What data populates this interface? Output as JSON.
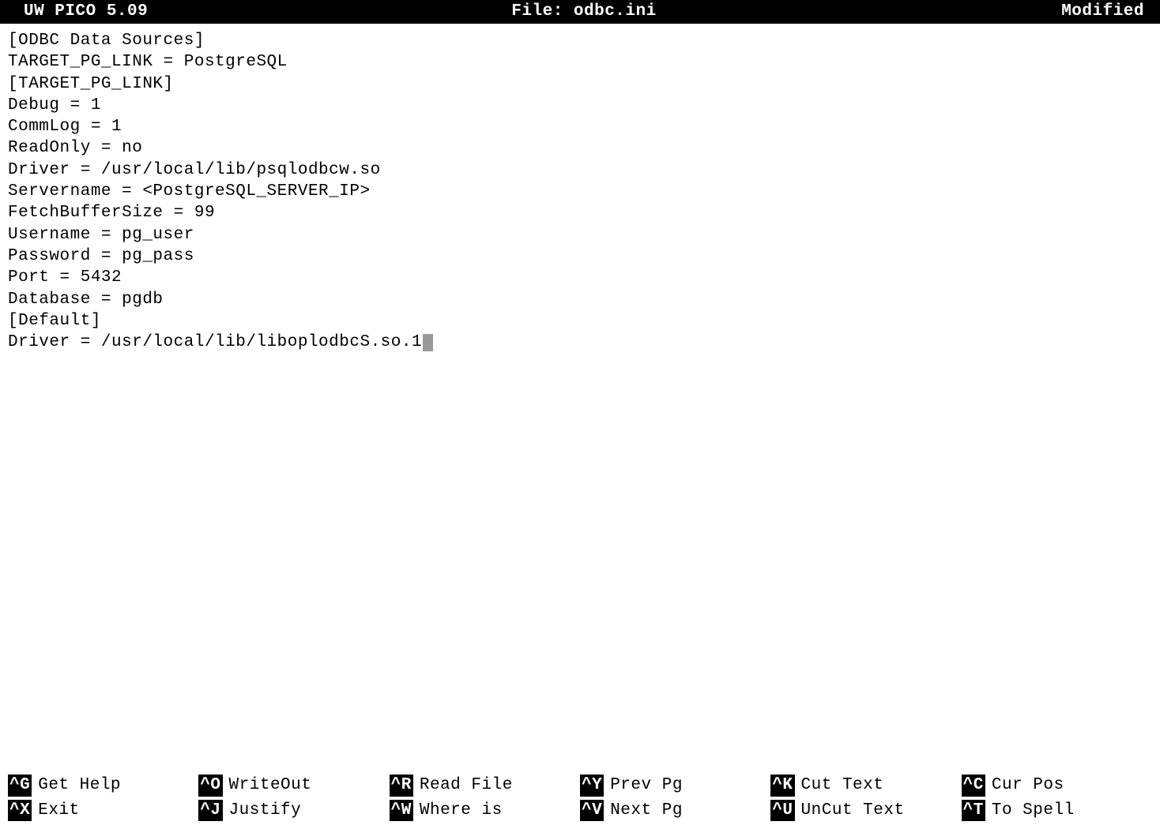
{
  "title_bar": {
    "left": "UW PICO 5.09",
    "center": "File: odbc.ini",
    "right": "Modified"
  },
  "editor": {
    "lines": [
      "[ODBC Data Sources]",
      "TARGET_PG_LINK = PostgreSQL",
      "[TARGET_PG_LINK]",
      "Debug = 1",
      "CommLog = 1",
      "ReadOnly = no",
      "Driver = /usr/local/lib/psqlodbcw.so",
      "Servername = <PostgreSQL_SERVER_IP>",
      "FetchBufferSize = 99",
      "Username = pg_user",
      "Password = pg_pass",
      "Port = 5432",
      "Database = pgdb",
      "[Default]",
      "Driver = /usr/local/lib/liboplodbcS.so.1"
    ],
    "cursor_line": 14
  },
  "shortcuts": [
    {
      "key": "^G",
      "label": "Get Help"
    },
    {
      "key": "^O",
      "label": "WriteOut"
    },
    {
      "key": "^R",
      "label": "Read File"
    },
    {
      "key": "^Y",
      "label": "Prev Pg"
    },
    {
      "key": "^K",
      "label": "Cut Text"
    },
    {
      "key": "^C",
      "label": "Cur Pos"
    },
    {
      "key": "^X",
      "label": "Exit"
    },
    {
      "key": "^J",
      "label": "Justify"
    },
    {
      "key": "^W",
      "label": "Where is"
    },
    {
      "key": "^V",
      "label": "Next Pg"
    },
    {
      "key": "^U",
      "label": "UnCut Text"
    },
    {
      "key": "^T",
      "label": "To Spell"
    }
  ]
}
